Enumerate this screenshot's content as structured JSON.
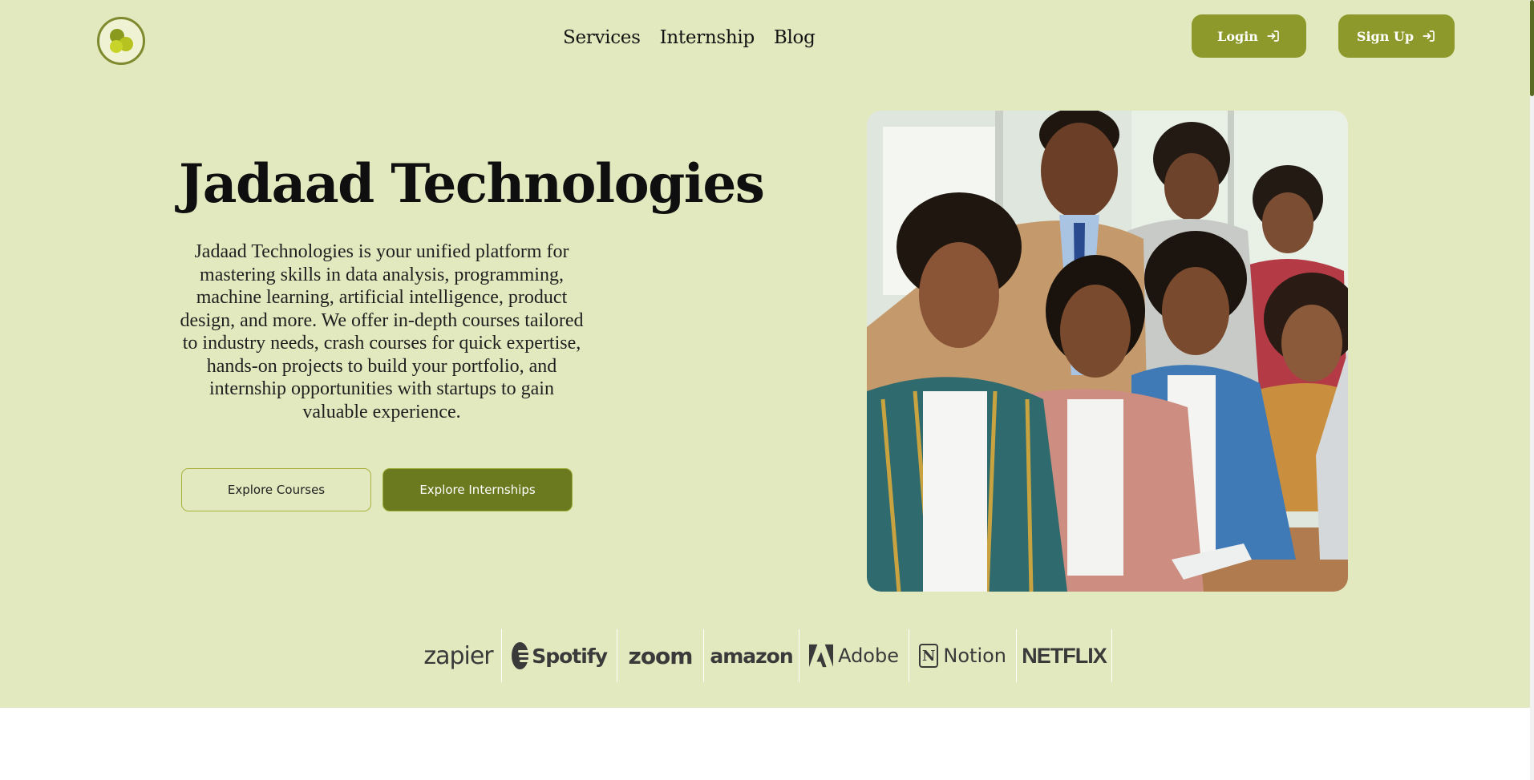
{
  "nav": {
    "items": [
      "Services",
      "Internship",
      "Blog"
    ],
    "login_label": "Login",
    "signup_label": "Sign Up"
  },
  "hero": {
    "title": "Jadaad Technologies",
    "description": "Jadaad Technologies is your unified platform for mastering skills in data analysis, programming, machine learning, artificial intelligence, product design, and more. We offer in-depth courses tailored to industry needs, crash courses for quick expertise, hands-on projects to build your portfolio, and internship opportunities with startups to gain valuable experience.",
    "cta_courses": "Explore Courses",
    "cta_internships": "Explore Internships"
  },
  "partners": [
    "zapier",
    "Spotify",
    "zoom",
    "amazon",
    "Adobe",
    "Notion",
    "NETFLIX"
  ],
  "colors": {
    "background": "#e3e9bf",
    "accent": "#8d9a2b",
    "accent_dark": "#6b7a1f"
  },
  "icons": {
    "logo": "jadaad-logo-icon",
    "login": "login-arrow-icon",
    "signup": "login-arrow-icon"
  }
}
